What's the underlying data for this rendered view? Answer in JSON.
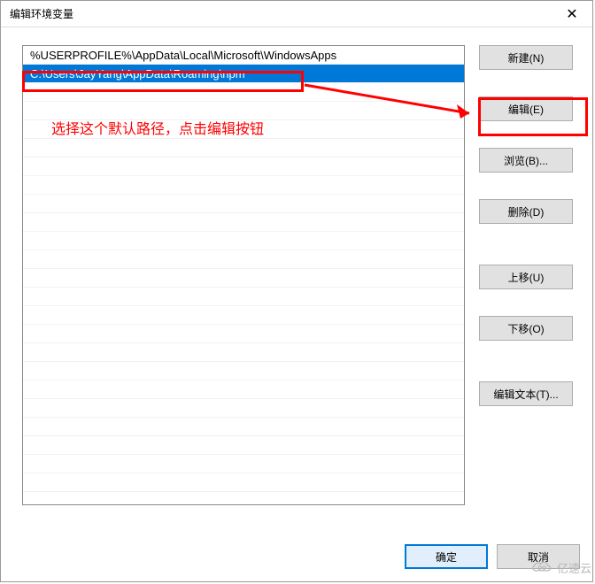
{
  "window": {
    "title": "编辑环境变量",
    "close_glyph": "✕"
  },
  "list": {
    "items": [
      {
        "text": "%USERPROFILE%\\AppData\\Local\\Microsoft\\WindowsApps",
        "selected": false
      },
      {
        "text": "C:\\Users\\JayYang\\AppData\\Roaming\\npm",
        "selected": true
      }
    ]
  },
  "buttons": {
    "new": "新建(N)",
    "edit": "编辑(E)",
    "browse": "浏览(B)...",
    "delete": "删除(D)",
    "move_up": "上移(U)",
    "move_down": "下移(O)",
    "edit_text": "编辑文本(T)...",
    "ok": "确定",
    "cancel": "取消"
  },
  "annotation": {
    "text": "选择这个默认路径，点击编辑按钮"
  },
  "watermark": {
    "text": "亿速云"
  }
}
